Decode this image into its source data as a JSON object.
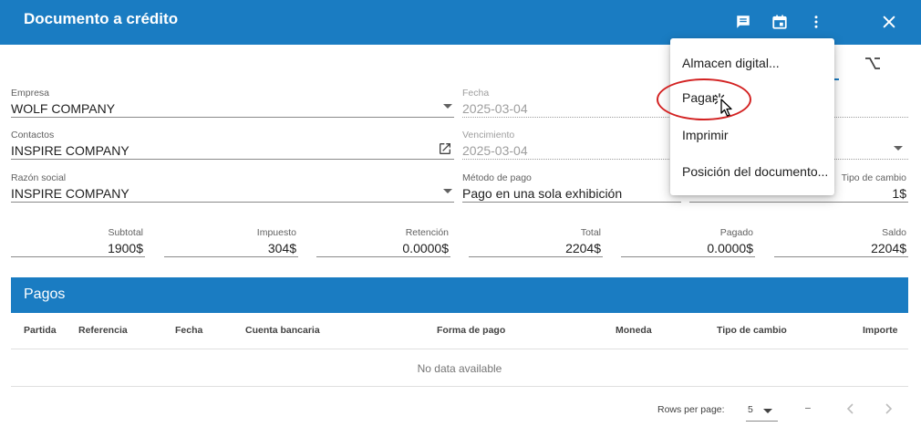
{
  "header": {
    "title": "Documento a crédito"
  },
  "form": {
    "empresa": {
      "label": "Empresa",
      "value": "WOLF COMPANY"
    },
    "fecha": {
      "label": "Fecha",
      "value": "2025-03-04"
    },
    "contactos": {
      "label": "Contactos",
      "value": "INSPIRE COMPANY"
    },
    "vencimiento": {
      "label": "Vencimiento",
      "value": "2025-03-04"
    },
    "razon_social": {
      "label": "Razón social",
      "value": "INSPIRE COMPANY"
    },
    "metodo_pago": {
      "label": "Método de pago",
      "value": "Pago en una sola exhibición"
    },
    "tipo_cambio": {
      "label": "Tipo de cambio",
      "value": "1$"
    }
  },
  "totals": {
    "subtotal": {
      "label": "Subtotal",
      "value": "1900$"
    },
    "impuesto": {
      "label": "Impuesto",
      "value": "304$"
    },
    "retencion": {
      "label": "Retención",
      "value": "0.0000$"
    },
    "total": {
      "label": "Total",
      "value": "2204$"
    },
    "pagado": {
      "label": "Pagado",
      "value": "0.0000$"
    },
    "saldo": {
      "label": "Saldo",
      "value": "2204$"
    }
  },
  "pagos": {
    "title": "Pagos",
    "columns": [
      "Partida",
      "Referencia",
      "Fecha",
      "Cuenta bancaria",
      "Forma de pago",
      "Moneda",
      "Tipo de cambio",
      "Importe"
    ],
    "empty_text": "No data available",
    "pager": {
      "rows_per_page_label": "Rows per page:",
      "rows_per_page_value": "5",
      "range": "–"
    }
  },
  "menu": {
    "items": [
      "Almacen digital...",
      "Pagar",
      "Imprimir",
      "Posición del documento..."
    ]
  }
}
